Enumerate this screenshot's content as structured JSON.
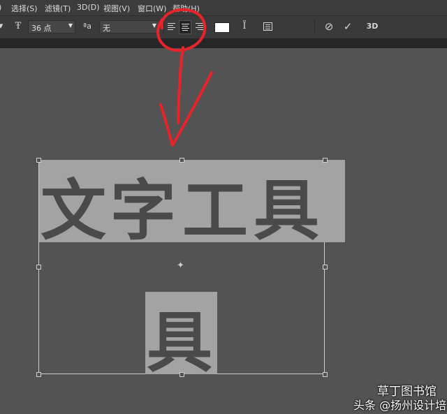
{
  "menu": [
    "选择(S)",
    "滤镜(T)",
    "3D(D)",
    "视图(V)",
    "窗口(W)",
    "帮助(H)"
  ],
  "options": {
    "font_size": "36 点",
    "aa_icon_label": "ªa",
    "aa_value": "无",
    "three_d_label": "3D",
    "text_color": "#ffffff"
  },
  "canvas": {
    "main_text": [
      "文",
      "字",
      "工",
      "具"
    ],
    "second_text": "具"
  },
  "annotation_color": "#e8232a",
  "watermark": {
    "line1": "草丁图书馆",
    "line2": "头条 @扬州设计培训"
  }
}
